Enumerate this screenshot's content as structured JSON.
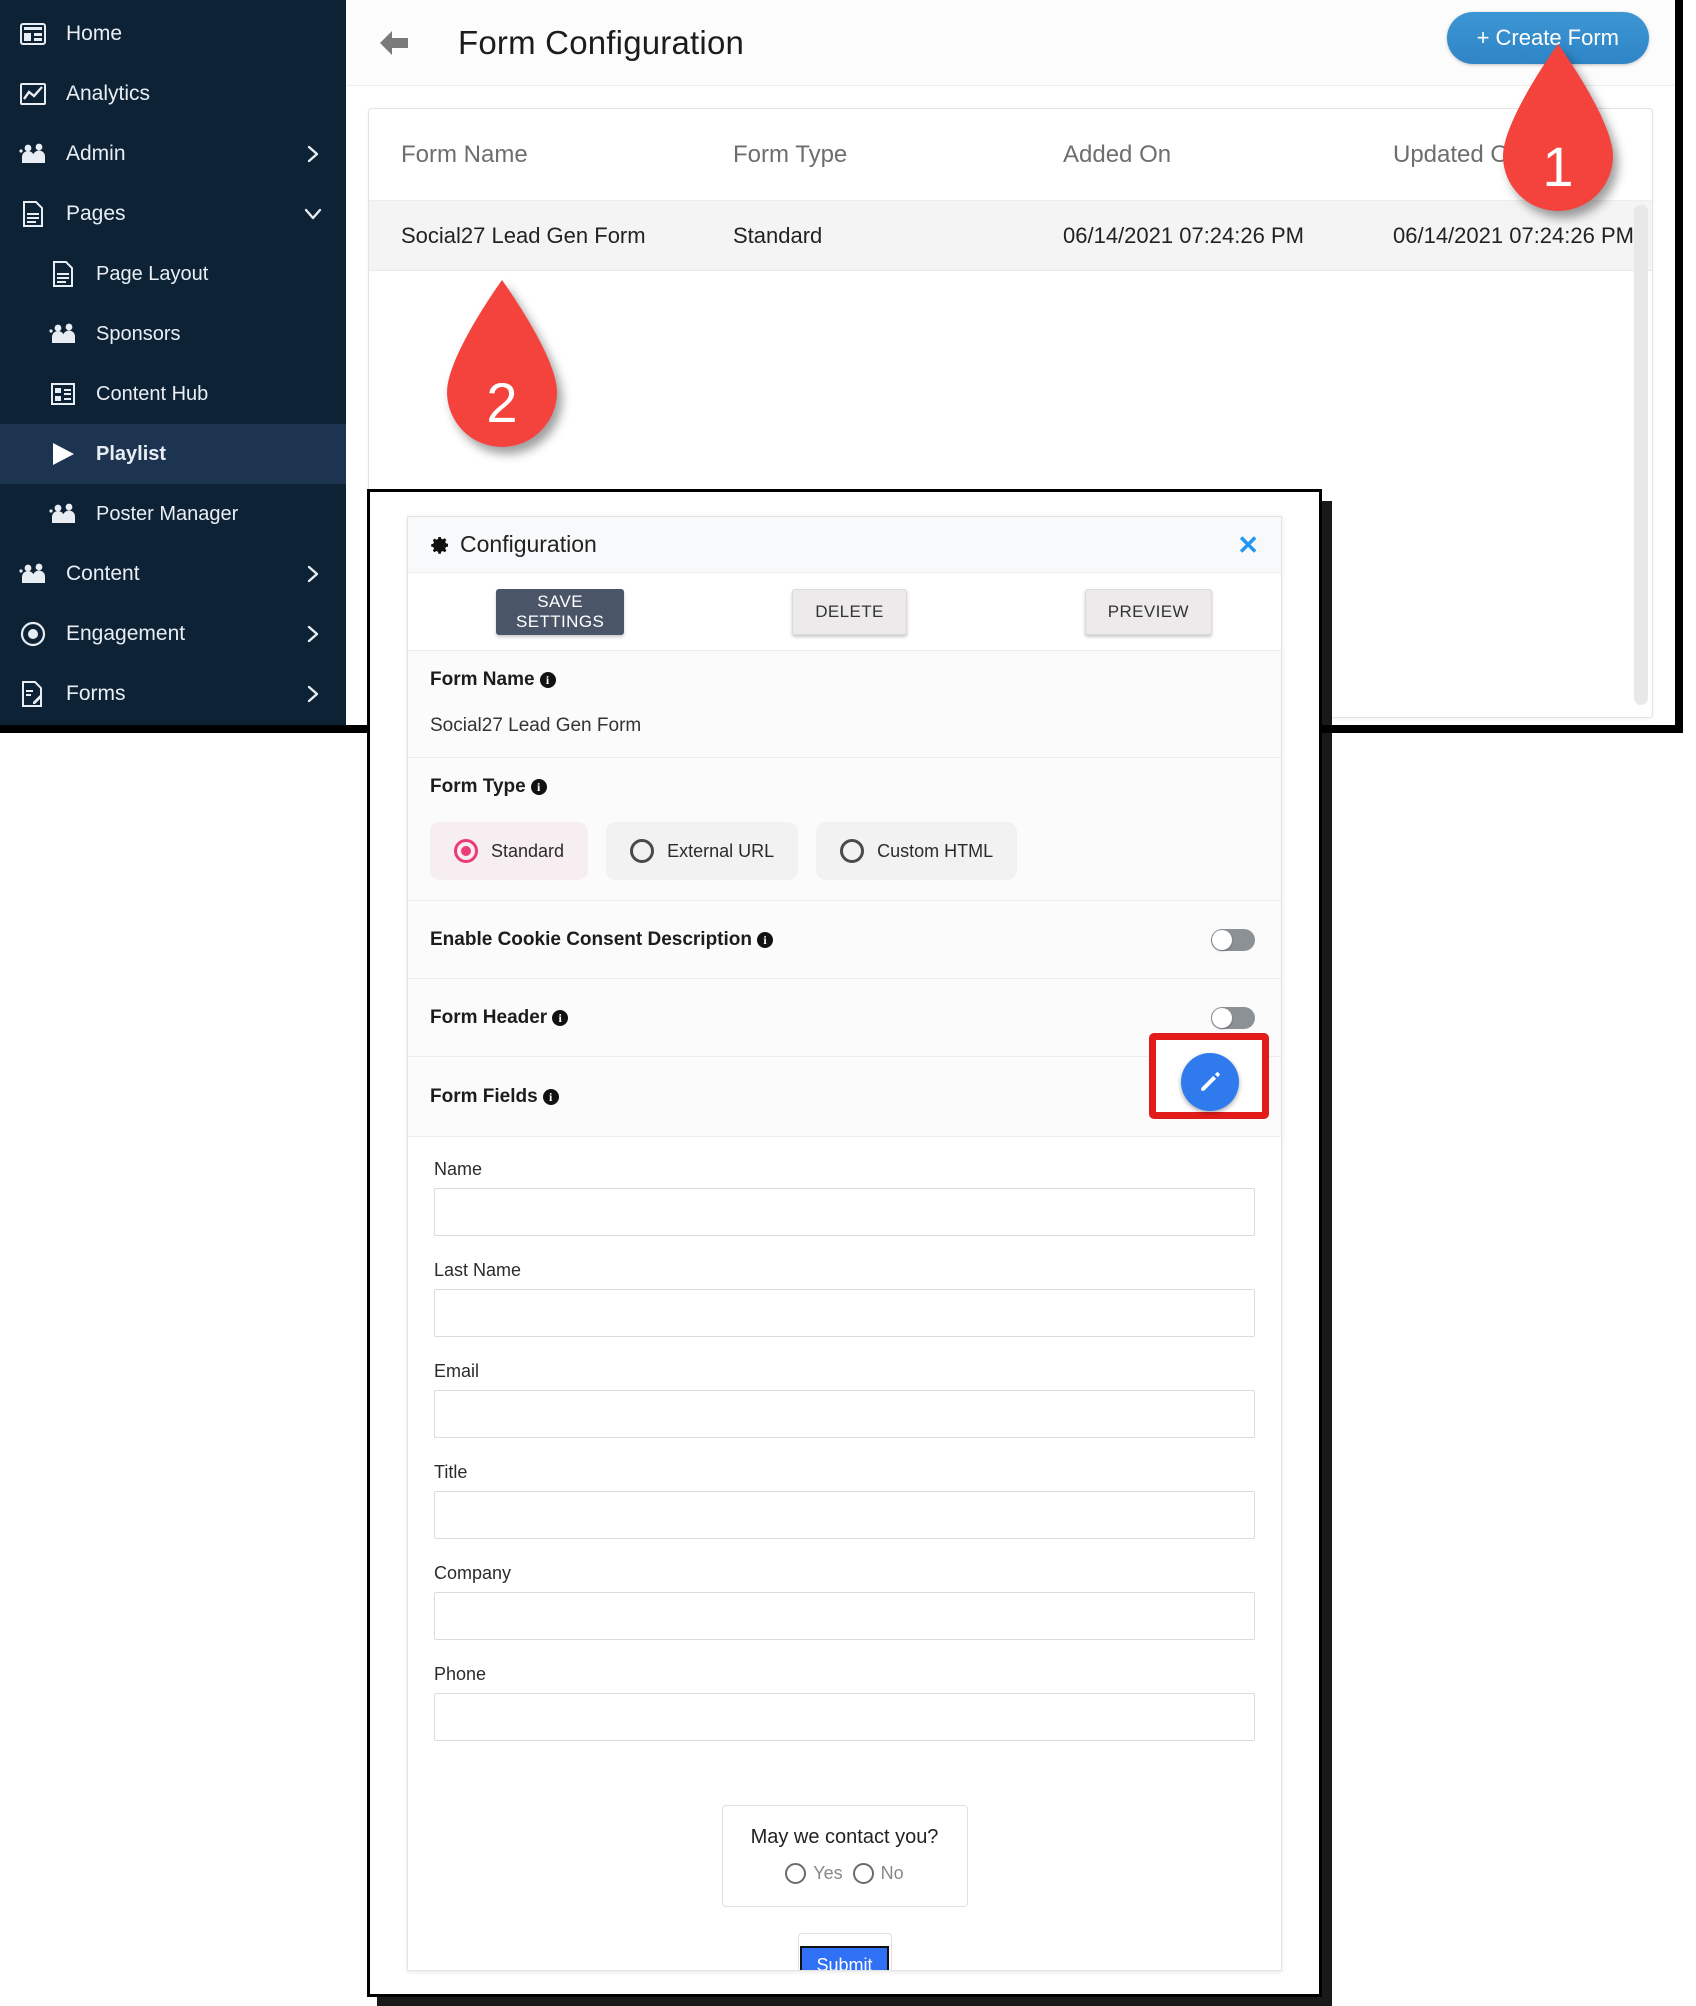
{
  "sidebar": {
    "items": [
      {
        "label": "Home",
        "icon": "dashboard-icon",
        "level": "top",
        "chevron": "none",
        "active": false
      },
      {
        "label": "Analytics",
        "icon": "chart-icon",
        "level": "top",
        "chevron": "none",
        "active": false
      },
      {
        "label": "Admin",
        "icon": "people-icon",
        "level": "top",
        "chevron": "right",
        "active": false
      },
      {
        "label": "Pages",
        "icon": "document-icon",
        "level": "top",
        "chevron": "down",
        "active": false
      },
      {
        "label": "Page Layout",
        "icon": "document-icon",
        "level": "sub",
        "chevron": "none",
        "active": false
      },
      {
        "label": "Sponsors",
        "icon": "people-icon",
        "level": "sub",
        "chevron": "none",
        "active": false
      },
      {
        "label": "Content Hub",
        "icon": "content-hub-icon",
        "level": "sub",
        "chevron": "none",
        "active": false
      },
      {
        "label": "Playlist",
        "icon": "play-icon",
        "level": "sub",
        "chevron": "none",
        "active": true
      },
      {
        "label": "Poster Manager",
        "icon": "people-icon",
        "level": "sub",
        "chevron": "none",
        "active": false
      },
      {
        "label": "Content",
        "icon": "people-icon",
        "level": "top",
        "chevron": "right",
        "active": false
      },
      {
        "label": "Engagement",
        "icon": "radio-icon",
        "level": "top",
        "chevron": "right",
        "active": false
      },
      {
        "label": "Forms",
        "icon": "form-edit-icon",
        "level": "top",
        "chevron": "right",
        "active": false
      }
    ]
  },
  "topbar": {
    "back_icon": "back-arrow-icon",
    "title": "Form Configuration",
    "create_button": "+ Create Form"
  },
  "forms_table": {
    "columns": [
      "Form Name",
      "Form Type",
      "Added On",
      "Updated On"
    ],
    "rows": [
      {
        "name": "Social27 Lead Gen Form",
        "type": "Standard",
        "added_on": "06/14/2021 07:24:26 PM",
        "updated_on": "06/14/2021 07:24:26 PM"
      }
    ]
  },
  "dialog": {
    "title": "Configuration",
    "gear_icon": "gear-icon",
    "close_icon": "close-icon",
    "actions": {
      "save": "SAVE SETTINGS",
      "delete": "DELETE",
      "preview": "PREVIEW"
    },
    "form_name": {
      "label": "Form Name",
      "value": "Social27 Lead Gen Form"
    },
    "form_type": {
      "label": "Form Type",
      "options": [
        {
          "label": "Standard",
          "selected": true
        },
        {
          "label": "External URL",
          "selected": false
        },
        {
          "label": "Custom HTML",
          "selected": false
        }
      ]
    },
    "cookie_consent": {
      "label": "Enable Cookie Consent Description",
      "enabled": false
    },
    "form_header": {
      "label": "Form Header",
      "enabled": false
    },
    "form_fields": {
      "label": "Form Fields",
      "edit_icon": "pencil-edit-icon"
    },
    "preview_fields": [
      {
        "label": "Name",
        "value": ""
      },
      {
        "label": "Last Name",
        "value": ""
      },
      {
        "label": "Email",
        "value": ""
      },
      {
        "label": "Title",
        "value": ""
      },
      {
        "label": "Company",
        "value": ""
      },
      {
        "label": "Phone",
        "value": ""
      }
    ],
    "contact_question": {
      "question": "May we contact you?",
      "options": [
        "Yes",
        "No"
      ]
    },
    "submit_label": "Submit"
  },
  "markers": [
    {
      "number": "1"
    },
    {
      "number": "2"
    }
  ],
  "colors": {
    "sidebar_bg": "#0e2236",
    "sidebar_active": "#1d3450",
    "accent_blue": "#3d96d4",
    "marker_red": "#f4433c",
    "radio_pink": "#ec3b78",
    "save_grey": "#4a5568",
    "submit_blue": "#2f70f5",
    "highlight_red": "#e21b1b"
  }
}
